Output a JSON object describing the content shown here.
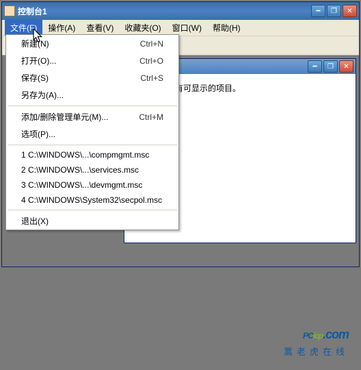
{
  "outer": {
    "title": "控制台1"
  },
  "menubar": {
    "file": "文件(F)",
    "action": "操作(A)",
    "view": "查看(V)",
    "favorites": "收藏夹(O)",
    "window": "窗口(W)",
    "help": "帮助(H)"
  },
  "dropdown": {
    "new": {
      "label": "新建(N)",
      "shortcut": "Ctrl+N"
    },
    "open": {
      "label": "打开(O)...",
      "shortcut": "Ctrl+O"
    },
    "save": {
      "label": "保存(S)",
      "shortcut": "Ctrl+S"
    },
    "saveas": {
      "label": "另存为(A)...",
      "shortcut": ""
    },
    "addremove": {
      "label": "添加/删除管理单元(M)...",
      "shortcut": "Ctrl+M"
    },
    "options": {
      "label": "选项(P)...",
      "shortcut": ""
    },
    "recent1": "1 C:\\WINDOWS\\...\\compmgmt.msc",
    "recent2": "2 C:\\WINDOWS\\...\\services.msc",
    "recent3": "3 C:\\WINDOWS\\...\\devmgmt.msc",
    "recent4": "4 C:\\WINDOWS\\System32\\secpol.msc",
    "exit": "退出(X)"
  },
  "inner": {
    "message": "此视图中没有可显示的项目。"
  },
  "watermark": {
    "part1": "PC",
    "part2": "icp",
    "part3": ".com",
    "sub": "蒿老虎在线"
  }
}
